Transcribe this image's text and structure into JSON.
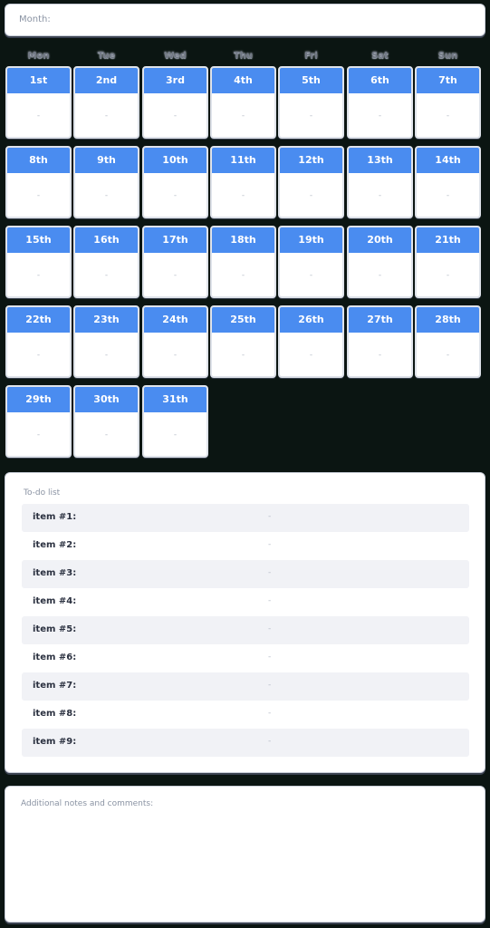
{
  "month": {
    "label": "Month:",
    "value": ""
  },
  "weekdays": [
    "Mon",
    "Tue",
    "Wed",
    "Thu",
    "Fri",
    "Sat",
    "Sun"
  ],
  "days": [
    {
      "label": "1st",
      "value": "-"
    },
    {
      "label": "2nd",
      "value": "-"
    },
    {
      "label": "3rd",
      "value": "-"
    },
    {
      "label": "4th",
      "value": "-"
    },
    {
      "label": "5th",
      "value": "-"
    },
    {
      "label": "6th",
      "value": "-"
    },
    {
      "label": "7th",
      "value": "-"
    },
    {
      "label": "8th",
      "value": "-"
    },
    {
      "label": "9th",
      "value": "-"
    },
    {
      "label": "10th",
      "value": "-"
    },
    {
      "label": "11th",
      "value": "-"
    },
    {
      "label": "12th",
      "value": "-"
    },
    {
      "label": "13th",
      "value": "-"
    },
    {
      "label": "14th",
      "value": "-"
    },
    {
      "label": "15th",
      "value": "-"
    },
    {
      "label": "16th",
      "value": "-"
    },
    {
      "label": "17th",
      "value": "-"
    },
    {
      "label": "18th",
      "value": "-"
    },
    {
      "label": "19th",
      "value": "-"
    },
    {
      "label": "20th",
      "value": "-"
    },
    {
      "label": "21th",
      "value": "-"
    },
    {
      "label": "22th",
      "value": "-"
    },
    {
      "label": "23th",
      "value": "-"
    },
    {
      "label": "24th",
      "value": "-"
    },
    {
      "label": "25th",
      "value": "-"
    },
    {
      "label": "26th",
      "value": "-"
    },
    {
      "label": "27th",
      "value": "-"
    },
    {
      "label": "28th",
      "value": "-"
    },
    {
      "label": "29th",
      "value": "-"
    },
    {
      "label": "30th",
      "value": "-"
    },
    {
      "label": "31th",
      "value": "-"
    }
  ],
  "todo": {
    "title": "To-do list",
    "items": [
      {
        "label": "item #1:",
        "value": "-"
      },
      {
        "label": "item #2:",
        "value": "-"
      },
      {
        "label": "item #3:",
        "value": "-"
      },
      {
        "label": "item #4:",
        "value": "-"
      },
      {
        "label": "item #5:",
        "value": "-"
      },
      {
        "label": "item #6:",
        "value": "-"
      },
      {
        "label": "item #7:",
        "value": "-"
      },
      {
        "label": "item #8:",
        "value": "-"
      },
      {
        "label": "item #9:",
        "value": "-"
      }
    ]
  },
  "notes": {
    "title": "Additional notes and comments:",
    "value": ""
  },
  "colors": {
    "accent": "#4a8cf0",
    "background": "#0b1512",
    "row_alt": "#f1f2f6"
  }
}
